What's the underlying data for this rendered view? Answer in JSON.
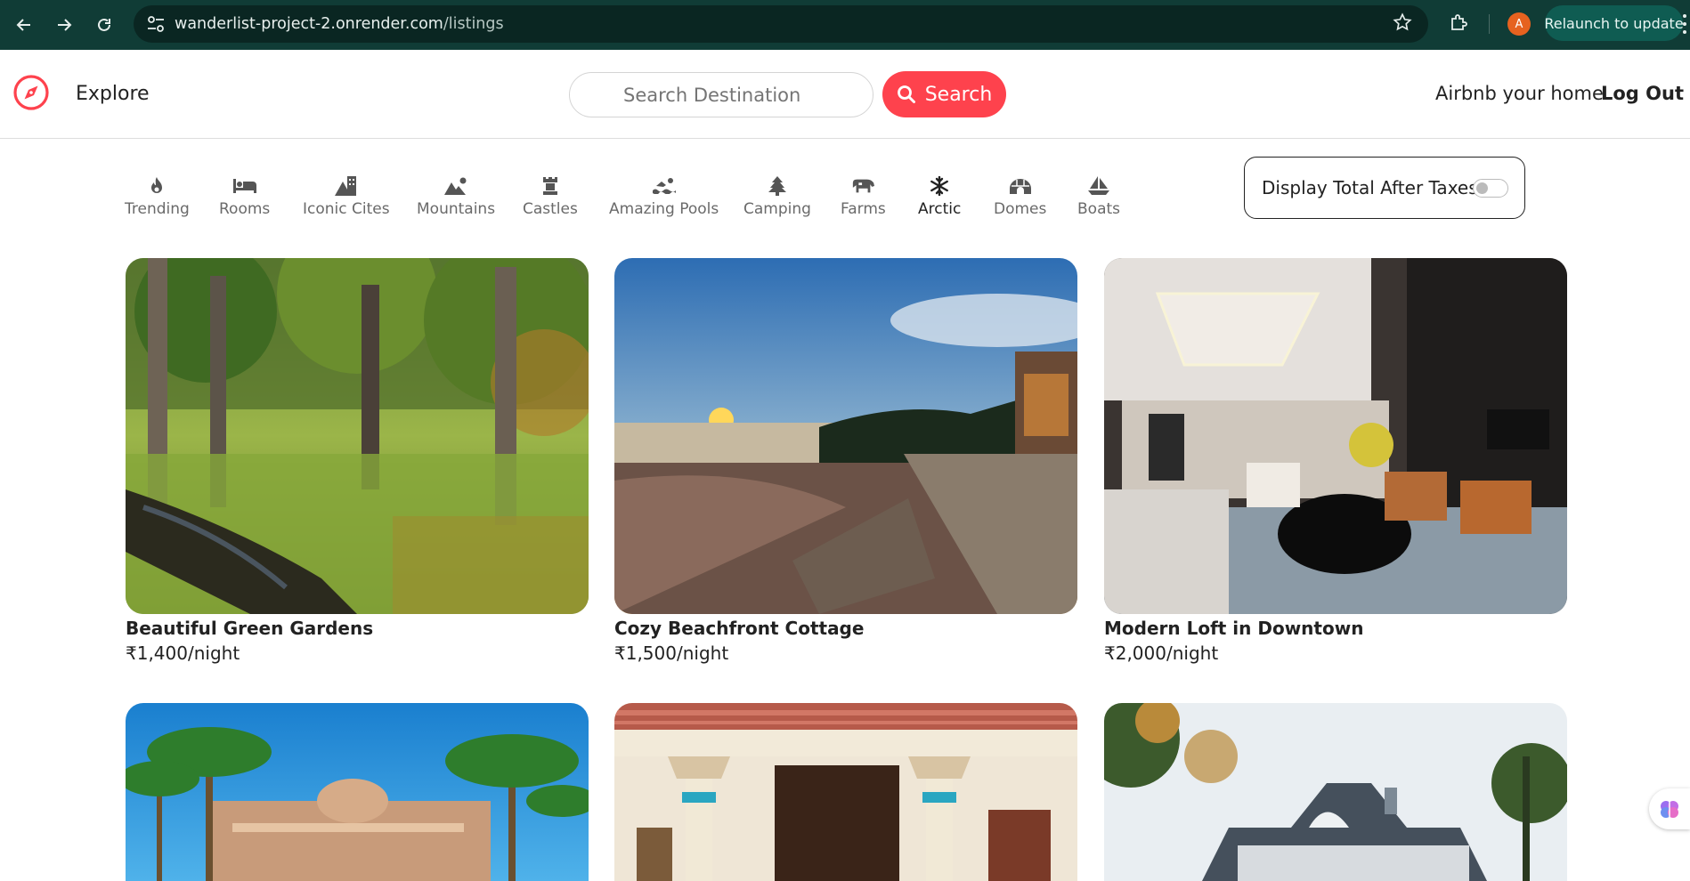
{
  "browser": {
    "url_host": "wanderlist-project-2.onrender.com",
    "url_path": "/listings",
    "profile_initial": "A",
    "relaunch_label": "Relaunch to update"
  },
  "header": {
    "explore_label": "Explore",
    "search_placeholder": "Search Destination",
    "search_button_label": "Search",
    "host_link_label": "Airbnb your home",
    "logout_label": "Log Out",
    "brand_color": "#fe424d"
  },
  "filters": [
    {
      "label": "Trending",
      "icon": "fire-icon"
    },
    {
      "label": "Rooms",
      "icon": "bed-icon"
    },
    {
      "label": "Iconic Cites",
      "icon": "mountain-city-icon"
    },
    {
      "label": "Mountains",
      "icon": "mountain-sun-icon"
    },
    {
      "label": "Castles",
      "icon": "chess-rook-icon"
    },
    {
      "label": "Amazing Pools",
      "icon": "person-swimming-icon"
    },
    {
      "label": "Camping",
      "icon": "tree-icon"
    },
    {
      "label": "Farms",
      "icon": "cow-icon"
    },
    {
      "label": "Arctic",
      "icon": "snowflake-icon"
    },
    {
      "label": "Domes",
      "icon": "igloo-icon"
    },
    {
      "label": "Boats",
      "icon": "sailboat-icon"
    }
  ],
  "tax_toggle": {
    "label": "Display Total After Taxes",
    "enabled": false
  },
  "listings": [
    {
      "title": "Beautiful Green Gardens",
      "price": "₹1,400/night",
      "image": "forest-garden-photo"
    },
    {
      "title": "Cozy Beachfront Cottage",
      "price": "₹1,500/night",
      "image": "sunset-lake-deck-photo"
    },
    {
      "title": "Modern Loft in Downtown",
      "price": "₹2,000/night",
      "image": "modern-living-room-photo"
    },
    {
      "title": "",
      "price": "",
      "image": "palace-palm-trees-photo"
    },
    {
      "title": "",
      "price": "",
      "image": "traditional-house-photo"
    },
    {
      "title": "",
      "price": "",
      "image": "suburban-house-photo"
    }
  ]
}
